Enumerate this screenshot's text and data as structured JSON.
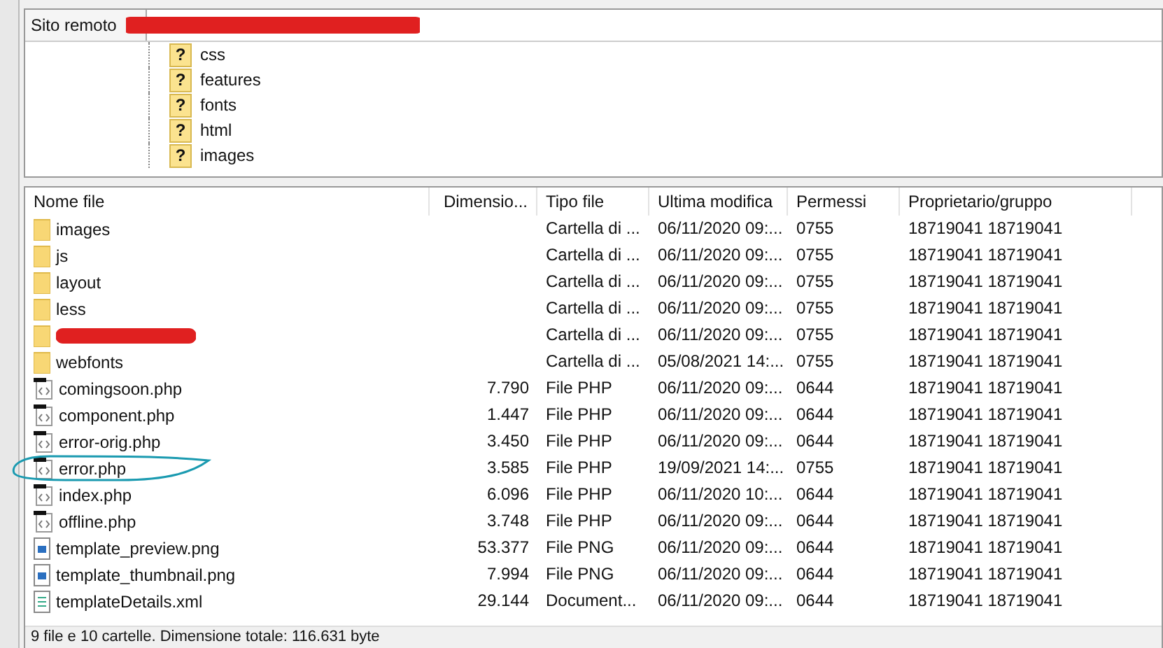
{
  "remote_site": {
    "label": "Sito remoto",
    "path_redacted": true
  },
  "tree": {
    "items": [
      {
        "icon": "?",
        "name": "css"
      },
      {
        "icon": "?",
        "name": "features"
      },
      {
        "icon": "?",
        "name": "fonts"
      },
      {
        "icon": "?",
        "name": "html"
      },
      {
        "icon": "?",
        "name": "images"
      }
    ]
  },
  "table": {
    "columns": [
      {
        "label": "Nome file"
      },
      {
        "label": "Dimensio..."
      },
      {
        "label": "Tipo file"
      },
      {
        "label": "Ultima modifica"
      },
      {
        "label": "Permessi"
      },
      {
        "label": "Proprietario/gruppo"
      }
    ],
    "rows": [
      {
        "kind": "folder",
        "name": "images",
        "size": "",
        "type": "Cartella di ...",
        "modified": "06/11/2020 09:...",
        "perms": "0755",
        "owner": "18719041 18719041",
        "redacted": false,
        "circled": false
      },
      {
        "kind": "folder",
        "name": "js",
        "size": "",
        "type": "Cartella di ...",
        "modified": "06/11/2020 09:...",
        "perms": "0755",
        "owner": "18719041 18719041",
        "redacted": false,
        "circled": false
      },
      {
        "kind": "folder",
        "name": "layout",
        "size": "",
        "type": "Cartella di ...",
        "modified": "06/11/2020 09:...",
        "perms": "0755",
        "owner": "18719041 18719041",
        "redacted": false,
        "circled": false
      },
      {
        "kind": "folder",
        "name": "less",
        "size": "",
        "type": "Cartella di ...",
        "modified": "06/11/2020 09:...",
        "perms": "0755",
        "owner": "18719041 18719041",
        "redacted": false,
        "circled": false
      },
      {
        "kind": "folder",
        "size": "",
        "type": "Cartella di ...",
        "modified": "06/11/2020 09:...",
        "perms": "0755",
        "owner": "18719041 18719041",
        "redacted": true,
        "circled": false
      },
      {
        "kind": "folder",
        "name": "webfonts",
        "size": "",
        "type": "Cartella di ...",
        "modified": "05/08/2021 14:...",
        "perms": "0755",
        "owner": "18719041 18719041",
        "redacted": false,
        "circled": false
      },
      {
        "kind": "php",
        "name": "comingsoon.php",
        "size": "7.790",
        "type": "File PHP",
        "modified": "06/11/2020 09:...",
        "perms": "0644",
        "owner": "18719041 18719041",
        "redacted": false,
        "circled": false
      },
      {
        "kind": "php",
        "name": "component.php",
        "size": "1.447",
        "type": "File PHP",
        "modified": "06/11/2020 09:...",
        "perms": "0644",
        "owner": "18719041 18719041",
        "redacted": false,
        "circled": false
      },
      {
        "kind": "php",
        "name": "error-orig.php",
        "size": "3.450",
        "type": "File PHP",
        "modified": "06/11/2020 09:...",
        "perms": "0644",
        "owner": "18719041 18719041",
        "redacted": false,
        "circled": false
      },
      {
        "kind": "php",
        "name": "error.php",
        "size": "3.585",
        "type": "File PHP",
        "modified": "19/09/2021 14:...",
        "perms": "0755",
        "owner": "18719041 18719041",
        "redacted": false,
        "circled": true
      },
      {
        "kind": "php",
        "name": "index.php",
        "size": "6.096",
        "type": "File PHP",
        "modified": "06/11/2020 10:...",
        "perms": "0644",
        "owner": "18719041 18719041",
        "redacted": false,
        "circled": false
      },
      {
        "kind": "php",
        "name": "offline.php",
        "size": "3.748",
        "type": "File PHP",
        "modified": "06/11/2020 09:...",
        "perms": "0644",
        "owner": "18719041 18719041",
        "redacted": false,
        "circled": false
      },
      {
        "kind": "png",
        "name": "template_preview.png",
        "size": "53.377",
        "type": "File PNG",
        "modified": "06/11/2020 09:...",
        "perms": "0644",
        "owner": "18719041 18719041",
        "redacted": false,
        "circled": false
      },
      {
        "kind": "png",
        "name": "template_thumbnail.png",
        "size": "7.994",
        "type": "File PNG",
        "modified": "06/11/2020 09:...",
        "perms": "0644",
        "owner": "18719041 18719041",
        "redacted": false,
        "circled": false
      },
      {
        "kind": "xml",
        "name": "templateDetails.xml",
        "size": "29.144",
        "type": "Document...",
        "modified": "06/11/2020 09:...",
        "perms": "0644",
        "owner": "18719041 18719041",
        "redacted": false,
        "circled": false
      }
    ]
  },
  "status_bar": {
    "text": "9 file e 10 cartelle. Dimensione totale: 116.631 byte"
  }
}
